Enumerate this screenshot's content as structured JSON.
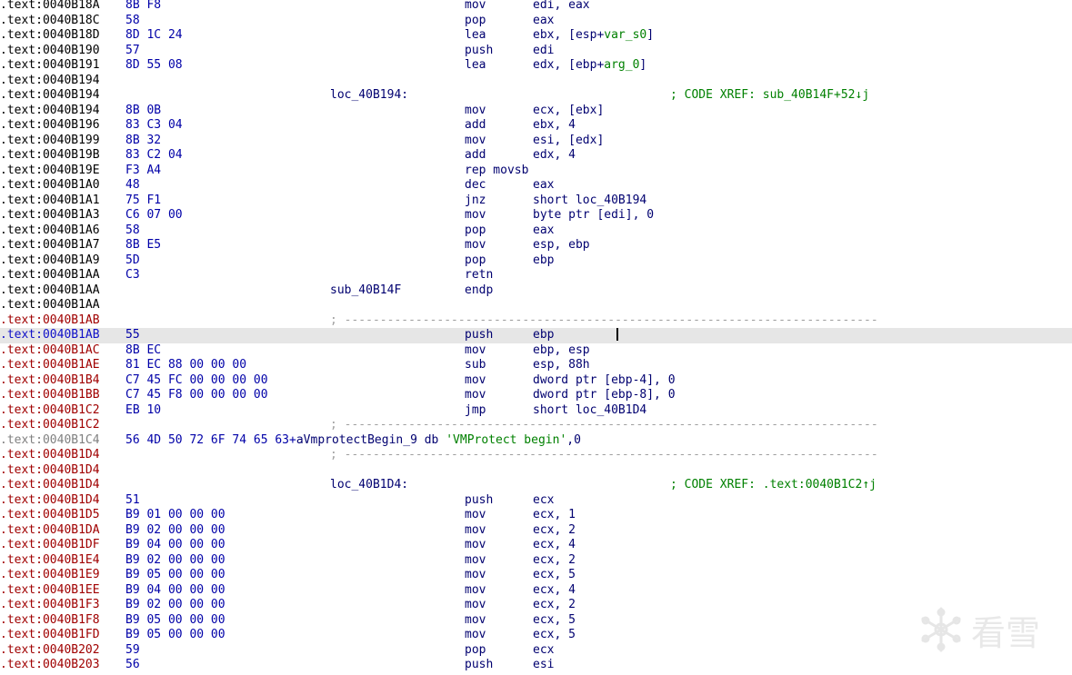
{
  "lines": [
    {
      "addr": ".text:0040B18A",
      "bytes": "8B F8",
      "mn": "mov",
      "op": "edi, eax",
      "addr_color": "black"
    },
    {
      "addr": ".text:0040B18C",
      "bytes": "58",
      "mn": "pop",
      "op": "eax",
      "addr_color": "black"
    },
    {
      "addr": ".text:0040B18D",
      "bytes": "8D 1C 24",
      "mn": "lea",
      "op": "ebx, [esp+",
      "op_var": "var_s0",
      "op_tail": "]",
      "addr_color": "black"
    },
    {
      "addr": ".text:0040B190",
      "bytes": "57",
      "mn": "push",
      "op": "edi",
      "addr_color": "black"
    },
    {
      "addr": ".text:0040B191",
      "bytes": "8D 55 08",
      "mn": "lea",
      "op": "edx, [ebp+",
      "op_var": "arg_0",
      "op_tail": "]",
      "addr_color": "black"
    },
    {
      "addr": ".text:0040B194",
      "addr_color": "black"
    },
    {
      "addr": ".text:0040B194",
      "label": "loc_40B194:",
      "comment": "; CODE XREF: sub_40B14F+52↓j",
      "addr_color": "black"
    },
    {
      "addr": ".text:0040B194",
      "bytes": "8B 0B",
      "mn": "mov",
      "op": "ecx, [ebx]",
      "addr_color": "black"
    },
    {
      "addr": ".text:0040B196",
      "bytes": "83 C3 04",
      "mn": "add",
      "op": "ebx, 4",
      "addr_color": "black"
    },
    {
      "addr": ".text:0040B199",
      "bytes": "8B 32",
      "mn": "mov",
      "op": "esi, [edx]",
      "addr_color": "black"
    },
    {
      "addr": ".text:0040B19B",
      "bytes": "83 C2 04",
      "mn": "add",
      "op": "edx, 4",
      "addr_color": "black"
    },
    {
      "addr": ".text:0040B19E",
      "bytes": "F3 A4",
      "mn": "rep movsb",
      "addr_color": "black"
    },
    {
      "addr": ".text:0040B1A0",
      "bytes": "48",
      "mn": "dec",
      "op": "eax",
      "addr_color": "black"
    },
    {
      "addr": ".text:0040B1A1",
      "bytes": "75 F1",
      "mn": "jnz",
      "op": "short loc_40B194",
      "addr_color": "black"
    },
    {
      "addr": ".text:0040B1A3",
      "bytes": "C6 07 00",
      "mn": "mov",
      "op": "byte ptr [edi], 0",
      "addr_color": "black"
    },
    {
      "addr": ".text:0040B1A6",
      "bytes": "58",
      "mn": "pop",
      "op": "eax",
      "addr_color": "black"
    },
    {
      "addr": ".text:0040B1A7",
      "bytes": "8B E5",
      "mn": "mov",
      "op": "esp, ebp",
      "addr_color": "black"
    },
    {
      "addr": ".text:0040B1A9",
      "bytes": "5D",
      "mn": "pop",
      "op": "ebp",
      "addr_color": "black"
    },
    {
      "addr": ".text:0040B1AA",
      "bytes": "C3",
      "mn": "retn",
      "addr_color": "black"
    },
    {
      "addr": ".text:0040B1AA",
      "label": "sub_40B14F",
      "mn": "endp",
      "addr_color": "black"
    },
    {
      "addr": ".text:0040B1AA",
      "addr_color": "black"
    },
    {
      "addr": ".text:0040B1AB",
      "sep": "; ---------------------------------------------------------------------------",
      "addr_color": "red"
    },
    {
      "addr": ".text:0040B1AB",
      "bytes": "55",
      "mn": "push",
      "op": "ebp",
      "addr_color": "red",
      "selected": true
    },
    {
      "addr": ".text:0040B1AC",
      "bytes": "8B EC",
      "mn": "mov",
      "op": "ebp, esp",
      "addr_color": "red"
    },
    {
      "addr": ".text:0040B1AE",
      "bytes": "81 EC 88 00 00 00",
      "mn": "sub",
      "op": "esp, 88h",
      "addr_color": "red"
    },
    {
      "addr": ".text:0040B1B4",
      "bytes": "C7 45 FC 00 00 00 00",
      "mn": "mov",
      "op": "dword ptr [ebp-4], 0",
      "addr_color": "red"
    },
    {
      "addr": ".text:0040B1BB",
      "bytes": "C7 45 F8 00 00 00 00",
      "mn": "mov",
      "op": "dword ptr [ebp-8], 0",
      "addr_color": "red"
    },
    {
      "addr": ".text:0040B1C2",
      "bytes": "EB 10",
      "mn": "jmp",
      "op": "short loc_40B1D4",
      "addr_color": "red"
    },
    {
      "addr": ".text:0040B1C2",
      "sep": "; ---------------------------------------------------------------------------",
      "addr_color": "red"
    },
    {
      "addr": ".text:0040B1C4",
      "data_bytes": "56 4D 50 72 6F 74 65 63+",
      "data_text": "aVmprotectBegin_9 db ",
      "data_str": "'VMProtect begin'",
      "data_tail": ",0",
      "addr_color": "gray"
    },
    {
      "addr": ".text:0040B1D4",
      "sep": "; ---------------------------------------------------------------------------",
      "addr_color": "red"
    },
    {
      "addr": ".text:0040B1D4",
      "addr_color": "red"
    },
    {
      "addr": ".text:0040B1D4",
      "label": "loc_40B1D4:",
      "comment": "; CODE XREF: .text:0040B1C2↑j",
      "addr_color": "red"
    },
    {
      "addr": ".text:0040B1D4",
      "bytes": "51",
      "mn": "push",
      "op": "ecx",
      "addr_color": "red"
    },
    {
      "addr": ".text:0040B1D5",
      "bytes": "B9 01 00 00 00",
      "mn": "mov",
      "op": "ecx, 1",
      "addr_color": "red"
    },
    {
      "addr": ".text:0040B1DA",
      "bytes": "B9 02 00 00 00",
      "mn": "mov",
      "op": "ecx, 2",
      "addr_color": "red"
    },
    {
      "addr": ".text:0040B1DF",
      "bytes": "B9 04 00 00 00",
      "mn": "mov",
      "op": "ecx, 4",
      "addr_color": "red"
    },
    {
      "addr": ".text:0040B1E4",
      "bytes": "B9 02 00 00 00",
      "mn": "mov",
      "op": "ecx, 2",
      "addr_color": "red"
    },
    {
      "addr": ".text:0040B1E9",
      "bytes": "B9 05 00 00 00",
      "mn": "mov",
      "op": "ecx, 5",
      "addr_color": "red"
    },
    {
      "addr": ".text:0040B1EE",
      "bytes": "B9 04 00 00 00",
      "mn": "mov",
      "op": "ecx, 4",
      "addr_color": "red"
    },
    {
      "addr": ".text:0040B1F3",
      "bytes": "B9 02 00 00 00",
      "mn": "mov",
      "op": "ecx, 2",
      "addr_color": "red"
    },
    {
      "addr": ".text:0040B1F8",
      "bytes": "B9 05 00 00 00",
      "mn": "mov",
      "op": "ecx, 5",
      "addr_color": "red"
    },
    {
      "addr": ".text:0040B1FD",
      "bytes": "B9 05 00 00 00",
      "mn": "mov",
      "op": "ecx, 5",
      "addr_color": "red"
    },
    {
      "addr": ".text:0040B202",
      "bytes": "59",
      "mn": "pop",
      "op": "ecx",
      "addr_color": "red"
    },
    {
      "addr": ".text:0040B203",
      "bytes": "56",
      "mn": "push",
      "op": "esi",
      "addr_color": "red"
    }
  ],
  "watermark": {
    "text": "看雪",
    "icon": "snowflake-icon",
    "color": "#e8e8e8"
  }
}
